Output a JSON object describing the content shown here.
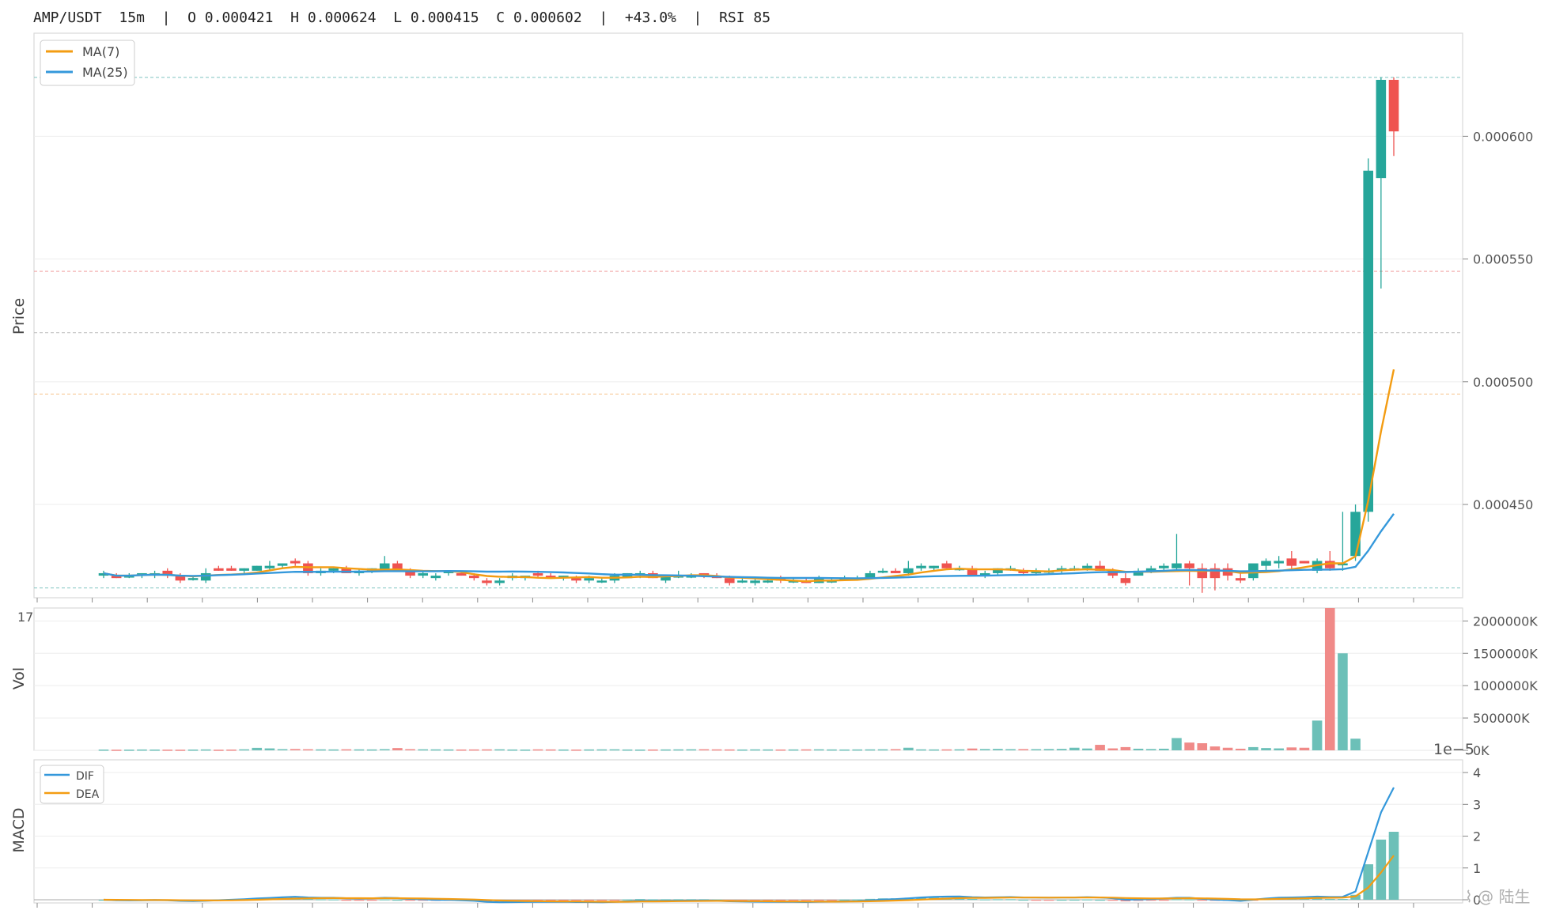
{
  "header": {
    "symbol": "AMP/USDT",
    "interval": "15m",
    "open": "O 0.000421",
    "high": "H 0.000624",
    "low": "L 0.000415",
    "close": "C 0.000602",
    "change": "+43.0%",
    "rsi": "RSI 85"
  },
  "watermark": "⌇ @ 陆生",
  "chart_data": [
    {
      "type": "candlestick",
      "panel": "price",
      "ylabel": "Price",
      "ylim": [
        0.000412,
        0.000642
      ],
      "yticks": [
        0.00045,
        0.0005,
        0.00055,
        0.0006
      ],
      "ytick_labels": [
        "0.000450",
        "0.000500",
        "0.000550",
        "0.000600"
      ],
      "xtick_label_partial": "17",
      "legend": [
        {
          "name": "MA(7)",
          "color": "#f39c12"
        },
        {
          "name": "MA(25)",
          "color": "#3498db"
        }
      ],
      "reference_lines": [
        {
          "value": 0.000624,
          "color": "#7fc4c0"
        },
        {
          "value": 0.000545,
          "color": "#f2a3a3"
        },
        {
          "value": 0.00052,
          "color": "#bbbbbb"
        },
        {
          "value": 0.000495,
          "color": "#f6c28b"
        },
        {
          "value": 0.000416,
          "color": "#7fc4c0"
        }
      ],
      "colors": {
        "up": "#26a69a",
        "down": "#ef5350"
      },
      "candles_ohlc": [
        [
          0.000421,
          0.000423,
          0.00042,
          0.000422
        ],
        [
          0.000421,
          0.000422,
          0.00042,
          0.00042
        ],
        [
          0.000421,
          0.000422,
          0.00042,
          0.000421
        ],
        [
          0.000421,
          0.000422,
          0.00042,
          0.000422
        ],
        [
          0.000421,
          0.000423,
          0.00042,
          0.000422
        ],
        [
          0.000423,
          0.000424,
          0.00042,
          0.000421
        ],
        [
          0.000421,
          0.000422,
          0.000418,
          0.000419
        ],
        [
          0.00042,
          0.000421,
          0.000419,
          0.00042
        ],
        [
          0.000419,
          0.000424,
          0.000418,
          0.000422
        ],
        [
          0.000424,
          0.000425,
          0.000423,
          0.000423
        ],
        [
          0.000424,
          0.000425,
          0.000423,
          0.000423
        ],
        [
          0.000423,
          0.000424,
          0.000422,
          0.000424
        ],
        [
          0.000423,
          0.000425,
          0.000423,
          0.000425
        ],
        [
          0.000424,
          0.000427,
          0.000423,
          0.000425
        ],
        [
          0.000425,
          0.000426,
          0.000424,
          0.000426
        ],
        [
          0.000427,
          0.000428,
          0.000425,
          0.000426
        ],
        [
          0.000426,
          0.000427,
          0.000421,
          0.000422
        ],
        [
          0.000422,
          0.000424,
          0.000421,
          0.000423
        ],
        [
          0.000423,
          0.000424,
          0.000422,
          0.000424
        ],
        [
          0.000424,
          0.000425,
          0.000422,
          0.000422
        ],
        [
          0.000422,
          0.000424,
          0.000421,
          0.000423
        ],
        [
          0.000423,
          0.000424,
          0.000422,
          0.000424
        ],
        [
          0.000423,
          0.000429,
          0.000423,
          0.000426
        ],
        [
          0.000426,
          0.000427,
          0.000423,
          0.000423
        ],
        [
          0.000423,
          0.000424,
          0.00042,
          0.000421
        ],
        [
          0.000421,
          0.000423,
          0.00042,
          0.000422
        ],
        [
          0.00042,
          0.000422,
          0.000419,
          0.000421
        ],
        [
          0.000422,
          0.000423,
          0.000421,
          0.000423
        ],
        [
          0.000422,
          0.000423,
          0.000421,
          0.000421
        ],
        [
          0.000421,
          0.000422,
          0.000419,
          0.00042
        ],
        [
          0.000419,
          0.00042,
          0.000417,
          0.000418
        ],
        [
          0.000418,
          0.00042,
          0.000417,
          0.000419
        ],
        [
          0.00042,
          0.000422,
          0.000419,
          0.000421
        ],
        [
          0.00042,
          0.000421,
          0.000419,
          0.000421
        ],
        [
          0.000422,
          0.000423,
          0.00042,
          0.000421
        ],
        [
          0.000421,
          0.000422,
          0.00042,
          0.00042
        ],
        [
          0.00042,
          0.000421,
          0.000419,
          0.000421
        ],
        [
          0.00042,
          0.000421,
          0.000418,
          0.000419
        ],
        [
          0.000419,
          0.000421,
          0.000418,
          0.00042
        ],
        [
          0.000419,
          0.00042,
          0.000418,
          0.000419
        ],
        [
          0.000419,
          0.000422,
          0.000418,
          0.000421
        ],
        [
          0.00042,
          0.000422,
          0.00042,
          0.000422
        ],
        [
          0.000421,
          0.000423,
          0.00042,
          0.000422
        ],
        [
          0.000422,
          0.000423,
          0.00042,
          0.00042
        ],
        [
          0.000419,
          0.000421,
          0.000418,
          0.000421
        ],
        [
          0.000421,
          0.000423,
          0.00042,
          0.000421
        ],
        [
          0.000421,
          0.000422,
          0.00042,
          0.000421
        ],
        [
          0.000422,
          0.000422,
          0.00042,
          0.000421
        ],
        [
          0.000421,
          0.000422,
          0.00042,
          0.00042
        ],
        [
          0.00042,
          0.000421,
          0.000417,
          0.000418
        ],
        [
          0.000419,
          0.00042,
          0.000418,
          0.000419
        ],
        [
          0.000418,
          0.00042,
          0.000417,
          0.000419
        ],
        [
          0.000419,
          0.00042,
          0.000418,
          0.000419
        ],
        [
          0.00042,
          0.000421,
          0.000418,
          0.000419
        ],
        [
          0.000419,
          0.00042,
          0.000418,
          0.000419
        ],
        [
          0.000419,
          0.00042,
          0.000418,
          0.000418
        ],
        [
          0.000418,
          0.000421,
          0.000418,
          0.00042
        ],
        [
          0.000419,
          0.00042,
          0.000418,
          0.000419
        ],
        [
          0.00042,
          0.000421,
          0.000419,
          0.00042
        ],
        [
          0.00042,
          0.000421,
          0.000419,
          0.00042
        ],
        [
          0.00042,
          0.000423,
          0.00042,
          0.000422
        ],
        [
          0.000423,
          0.000424,
          0.000422,
          0.000423
        ],
        [
          0.000423,
          0.000424,
          0.000422,
          0.000422
        ],
        [
          0.000422,
          0.000427,
          0.000421,
          0.000424
        ],
        [
          0.000424,
          0.000426,
          0.000423,
          0.000425
        ],
        [
          0.000424,
          0.000425,
          0.000423,
          0.000425
        ],
        [
          0.000426,
          0.000427,
          0.000424,
          0.000424
        ],
        [
          0.000424,
          0.000425,
          0.000423,
          0.000424
        ],
        [
          0.000424,
          0.000425,
          0.000421,
          0.000421
        ],
        [
          0.000421,
          0.000423,
          0.00042,
          0.000422
        ],
        [
          0.000422,
          0.000424,
          0.000421,
          0.000424
        ],
        [
          0.000424,
          0.000425,
          0.000423,
          0.000424
        ],
        [
          0.000423,
          0.000424,
          0.000421,
          0.000422
        ],
        [
          0.000422,
          0.000424,
          0.000421,
          0.000423
        ],
        [
          0.000423,
          0.000424,
          0.000422,
          0.000423
        ],
        [
          0.000423,
          0.000425,
          0.000422,
          0.000424
        ],
        [
          0.000424,
          0.000425,
          0.000423,
          0.000424
        ],
        [
          0.000424,
          0.000426,
          0.000423,
          0.000425
        ],
        [
          0.000425,
          0.000427,
          0.000423,
          0.000423
        ],
        [
          0.000423,
          0.000424,
          0.00042,
          0.000421
        ],
        [
          0.00042,
          0.000422,
          0.000417,
          0.000418
        ],
        [
          0.000421,
          0.000424,
          0.000421,
          0.000423
        ],
        [
          0.000423,
          0.000425,
          0.000422,
          0.000424
        ],
        [
          0.000424,
          0.000426,
          0.000423,
          0.000425
        ],
        [
          0.000424,
          0.000438,
          0.000423,
          0.000426
        ],
        [
          0.000426,
          0.000427,
          0.000417,
          0.000424
        ],
        [
          0.000424,
          0.000426,
          0.000414,
          0.00042
        ],
        [
          0.000424,
          0.000426,
          0.000415,
          0.00042
        ],
        [
          0.000424,
          0.000426,
          0.000419,
          0.000421
        ],
        [
          0.00042,
          0.000422,
          0.000418,
          0.000419
        ],
        [
          0.00042,
          0.000424,
          0.000419,
          0.000426
        ],
        [
          0.000425,
          0.000428,
          0.000423,
          0.000427
        ],
        [
          0.000426,
          0.000429,
          0.000424,
          0.000427
        ],
        [
          0.000428,
          0.000431,
          0.000423,
          0.000425
        ],
        [
          0.000427,
          0.000427,
          0.000426,
          0.000426
        ],
        [
          0.000423,
          0.000428,
          0.000422,
          0.000427
        ],
        [
          0.000427,
          0.000431,
          0.000423,
          0.000424
        ],
        [
          0.000426,
          0.000447,
          0.000423,
          0.000426
        ],
        [
          0.000429,
          0.00045,
          0.000427,
          0.000447
        ],
        [
          0.000447,
          0.000591,
          0.000443,
          0.000586
        ],
        [
          0.000583,
          0.000624,
          0.000538,
          0.000623
        ],
        [
          0.000623,
          0.000624,
          0.000592,
          0.000602
        ]
      ]
    },
    {
      "type": "bar",
      "panel": "volume",
      "ylabel": "Vol",
      "ylim": [
        0,
        2200000
      ],
      "yticks": [
        0,
        500000,
        1000000,
        1500000,
        2000000
      ],
      "ytick_labels": [
        "0K",
        "500000K",
        "1000000K",
        "1500000K",
        "2000000K"
      ],
      "values": [
        12000,
        10000,
        11000,
        13000,
        12000,
        11000,
        10000,
        12000,
        14000,
        10000,
        12000,
        16000,
        38000,
        30000,
        18000,
        20000,
        17000,
        15000,
        14000,
        16000,
        15000,
        14000,
        18000,
        35000,
        18000,
        16000,
        15000,
        14000,
        13000,
        14000,
        15000,
        16000,
        13000,
        12000,
        15000,
        14000,
        13000,
        12000,
        14000,
        15000,
        16000,
        13000,
        12000,
        13000,
        14000,
        15000,
        16000,
        17000,
        15000,
        14000,
        13000,
        15000,
        14000,
        13000,
        14000,
        15000,
        16000,
        14000,
        13000,
        14000,
        15000,
        16000,
        18000,
        40000,
        15000,
        14000,
        15000,
        16000,
        28000,
        20000,
        22000,
        18000,
        19000,
        18000,
        20000,
        22000,
        40000,
        28000,
        85000,
        30000,
        50000,
        25000,
        20000,
        25000,
        190000,
        120000,
        110000,
        60000,
        40000,
        25000,
        50000,
        35000,
        30000,
        45000,
        40000,
        460000,
        2200000,
        1500000,
        180000
      ]
    },
    {
      "type": "line+bar",
      "panel": "macd",
      "ylabel": "MACD",
      "scale_label": "1e−5",
      "ylim": [
        -0.1,
        4.4
      ],
      "yticks": [
        0,
        1,
        2,
        3,
        4
      ],
      "ytick_labels": [
        "0",
        "1",
        "2",
        "3",
        "4"
      ],
      "legend": [
        {
          "name": "DIF",
          "color": "#3498db"
        },
        {
          "name": "DEA",
          "color": "#f39c12"
        }
      ]
    }
  ]
}
